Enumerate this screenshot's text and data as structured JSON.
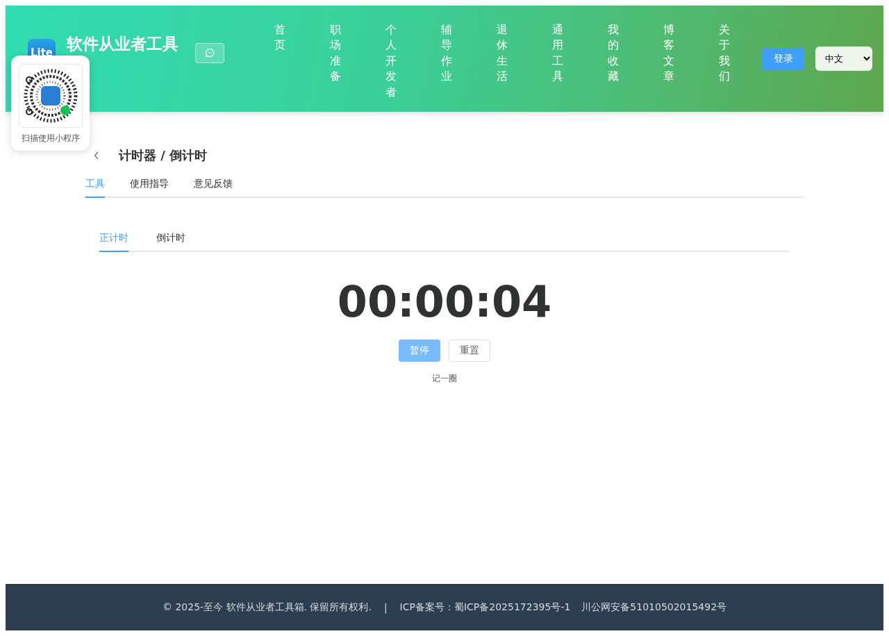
{
  "header": {
    "logo_text": "Lite",
    "site_title": "软件从业者工具",
    "nav": [
      {
        "label": "首页"
      },
      {
        "label": "职场准备"
      },
      {
        "label": "个人开发者"
      },
      {
        "label": "辅导作业"
      },
      {
        "label": "退休生活"
      },
      {
        "label": "通用工具"
      },
      {
        "label": "我的收藏"
      },
      {
        "label": "博客文章"
      },
      {
        "label": "关于我们"
      }
    ],
    "login_button": "登录",
    "language": "中文"
  },
  "qr_popup": {
    "caption": "扫描使用小程序"
  },
  "page": {
    "title": "计时器 / 倒计时",
    "tabs": [
      {
        "label": "工具",
        "selected": true
      },
      {
        "label": "使用指导",
        "selected": false
      },
      {
        "label": "意见反馈",
        "selected": false
      }
    ],
    "timer_tabs": [
      {
        "label": "正计时",
        "selected": true
      },
      {
        "label": "倒计时",
        "selected": false
      }
    ],
    "time": "00:00:04",
    "pause_button": "暂停",
    "reset_button": "重置",
    "lap_button": "记一圈"
  },
  "footer": {
    "copyright": "© 2025-至今 软件从业者工具箱. 保留所有权利.",
    "separator": "|",
    "icp": "ICP备案号：蜀ICP备2025172395号-1",
    "police": "川公网安备51010502015492号"
  }
}
